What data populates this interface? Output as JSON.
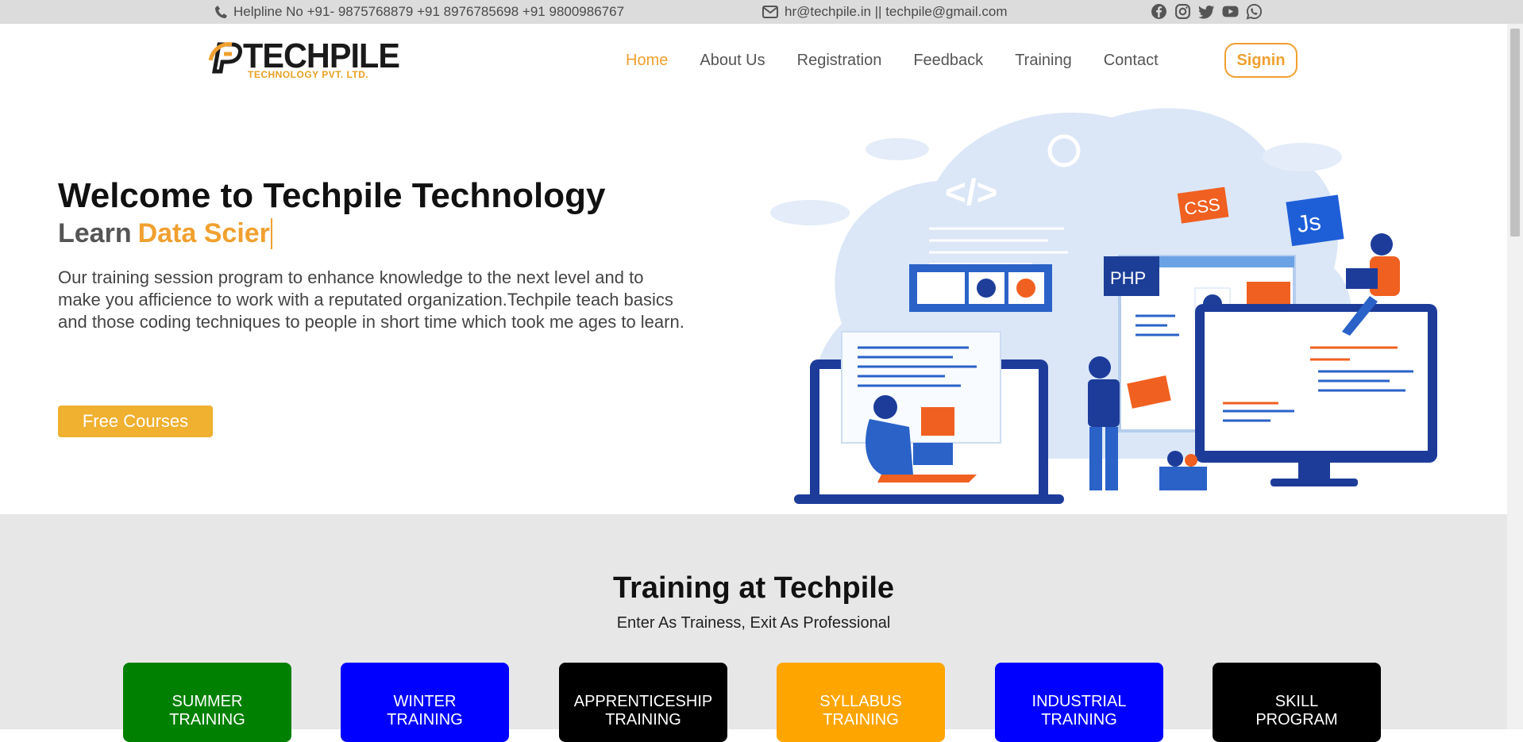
{
  "topbar": {
    "helpline": "Helpline No +91- 9875768879 +91 8976785698 +91 9800986767",
    "email": "hr@techpile.in || techpile@gmail.com",
    "socials": [
      "facebook-icon",
      "instagram-icon",
      "twitter-icon",
      "youtube-icon",
      "whatsapp-icon"
    ]
  },
  "logo": {
    "name": "TECHPILE",
    "tagline": "TECHNOLOGY PVT. LTD."
  },
  "nav": {
    "items": [
      "Home",
      "About Us",
      "Registration",
      "Feedback",
      "Training",
      "Contact"
    ],
    "active": "Home",
    "signin": "Signin"
  },
  "hero": {
    "title": "Welcome to Techpile Technology",
    "learn": "Learn",
    "typed": "Data Scier",
    "description": "Our training session program to enhance knowledge to the next level and to make you afficience to work with a reputated organization.Techpile teach basics and those coding techniques to people in short time which took me ages to learn.",
    "cta": "Free Courses",
    "illustration_labels": {
      "css": "CSS",
      "js": "Js",
      "php": "PHP",
      "code": "</>"
    }
  },
  "training": {
    "title": "Training at Techpile",
    "subtitle": "Enter As Trainess, Exit As Professional",
    "cards": [
      {
        "line1": "SUMMER",
        "line2": "TRAINING",
        "color": "#008000"
      },
      {
        "line1": "WINTER",
        "line2": "TRAINING",
        "color": "#0000ff"
      },
      {
        "line1": "APPRENTICESHIP",
        "line2": "TRAINING",
        "color": "#000000"
      },
      {
        "line1": "SYLLABUS",
        "line2": "TRAINING",
        "color": "#ffa500"
      },
      {
        "line1": "INDUSTRIAL",
        "line2": "TRAINING",
        "color": "#0000ff"
      },
      {
        "line1": "SKILL",
        "line2": "PROGRAM",
        "color": "#000000"
      }
    ]
  },
  "colors": {
    "accent": "#f0a030",
    "topbar_bg": "#dcdcdc",
    "section_bg": "#e8e7e8"
  }
}
